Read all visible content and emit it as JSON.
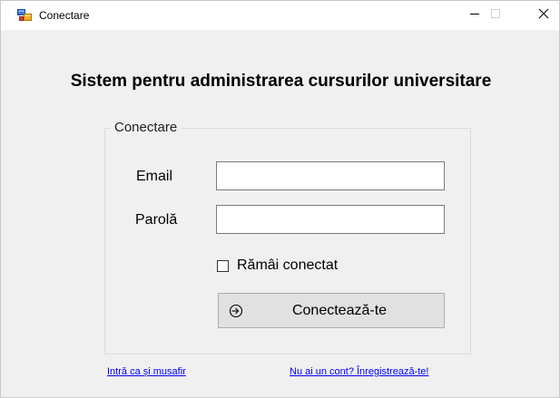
{
  "window": {
    "title": "Conectare",
    "app_icon": "windows-form-icon",
    "controls": {
      "minimize_icon": "minimize-icon",
      "maximize_icon": "maximize-icon",
      "close_icon": "close-icon"
    }
  },
  "main": {
    "heading": "Sistem pentru administrarea cursurilor universitare"
  },
  "login_group": {
    "title": "Conectare",
    "email_label": "Email",
    "email_value": "",
    "password_label": "Parolă",
    "password_value": "",
    "remember_label": "Rămâi conectat",
    "remember_checked": false,
    "connect_button_label": "Conectează-te",
    "connect_button_icon": "login-arrow-icon"
  },
  "footer": {
    "guest_link": "Intră ca și musafir",
    "register_link": "Nu ai un cont? Înregistrează-te!"
  },
  "colors": {
    "window_background": "#f0f0f0",
    "titlebar_background": "#ffffff",
    "link": "#0000ff",
    "button_background": "#e1e1e1"
  }
}
